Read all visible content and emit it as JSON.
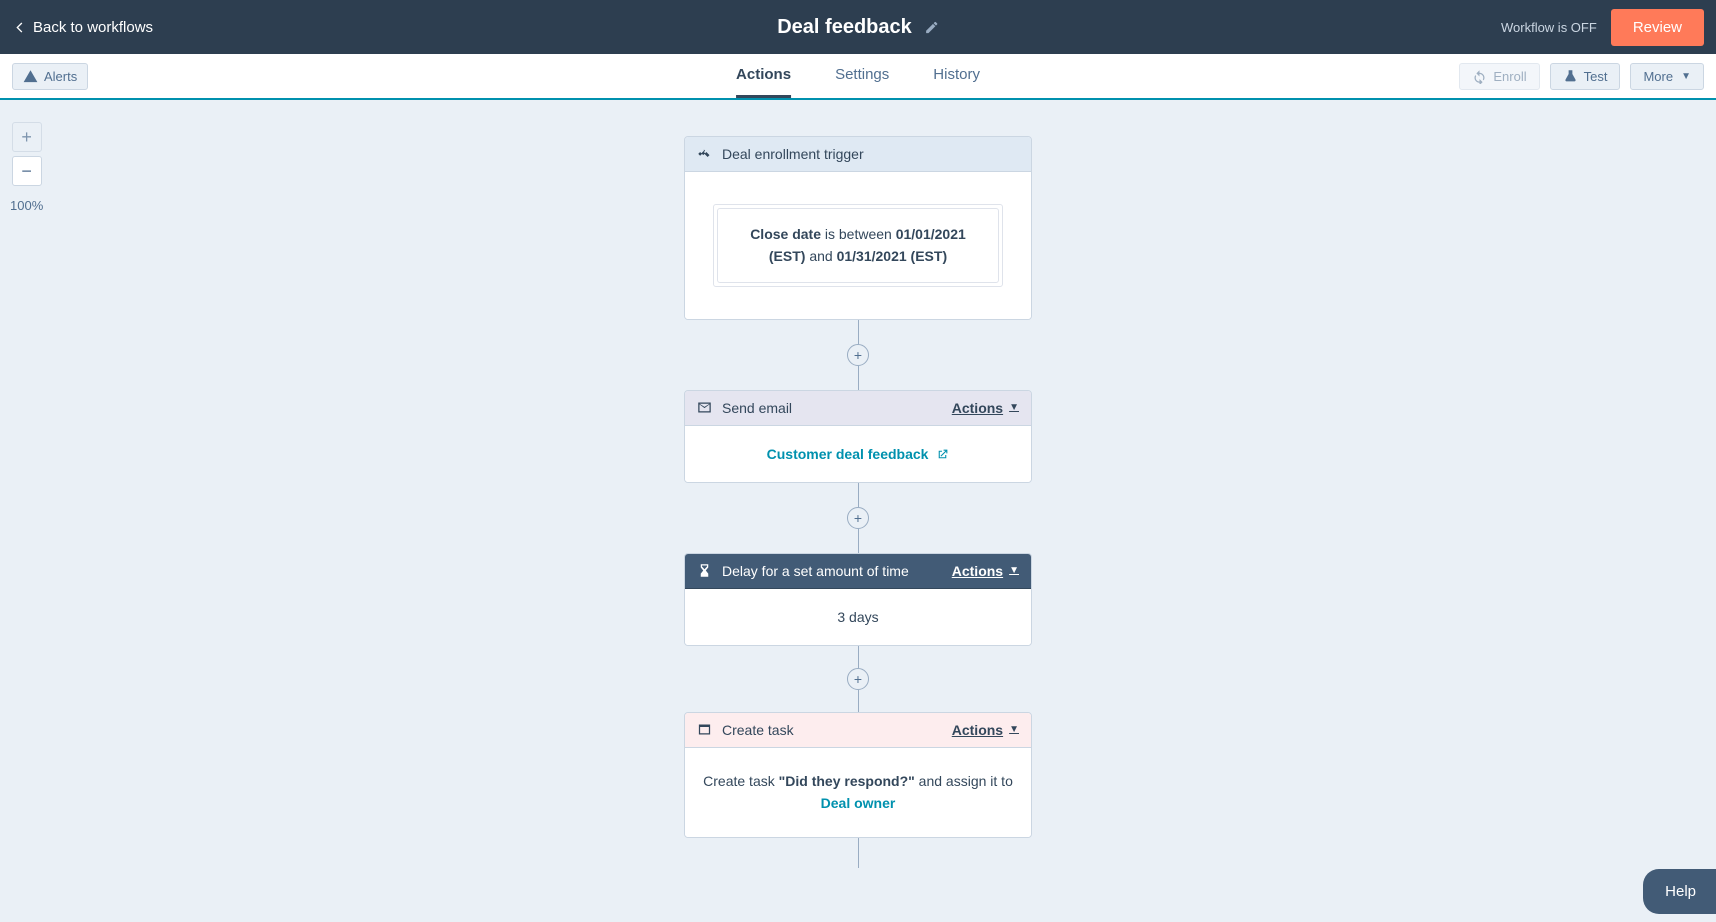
{
  "header": {
    "back_label": "Back to workflows",
    "title": "Deal feedback",
    "status": "Workflow is OFF",
    "review_label": "Review"
  },
  "subheader": {
    "alerts_label": "Alerts",
    "tabs": {
      "actions": "Actions",
      "settings": "Settings",
      "history": "History"
    },
    "enroll_label": "Enroll",
    "test_label": "Test",
    "more_label": "More"
  },
  "zoom": {
    "level": "100%"
  },
  "flow": {
    "trigger": {
      "title": "Deal enrollment trigger",
      "field": "Close date",
      "between_word": " is between ",
      "date1": "01/01/2021 (EST)",
      "and_word": " and ",
      "date2": "01/31/2021 (EST)"
    },
    "email": {
      "title": "Send email",
      "actions_label": "Actions",
      "link": "Customer deal feedback"
    },
    "delay": {
      "title": "Delay for a set amount of time",
      "actions_label": "Actions",
      "value": "3 days"
    },
    "task": {
      "title": "Create task",
      "actions_label": "Actions",
      "prefix": "Create task ",
      "name": "\"Did they respond?\"",
      "mid": " and assign it to ",
      "assignee": "Deal owner"
    }
  },
  "help_label": "Help"
}
